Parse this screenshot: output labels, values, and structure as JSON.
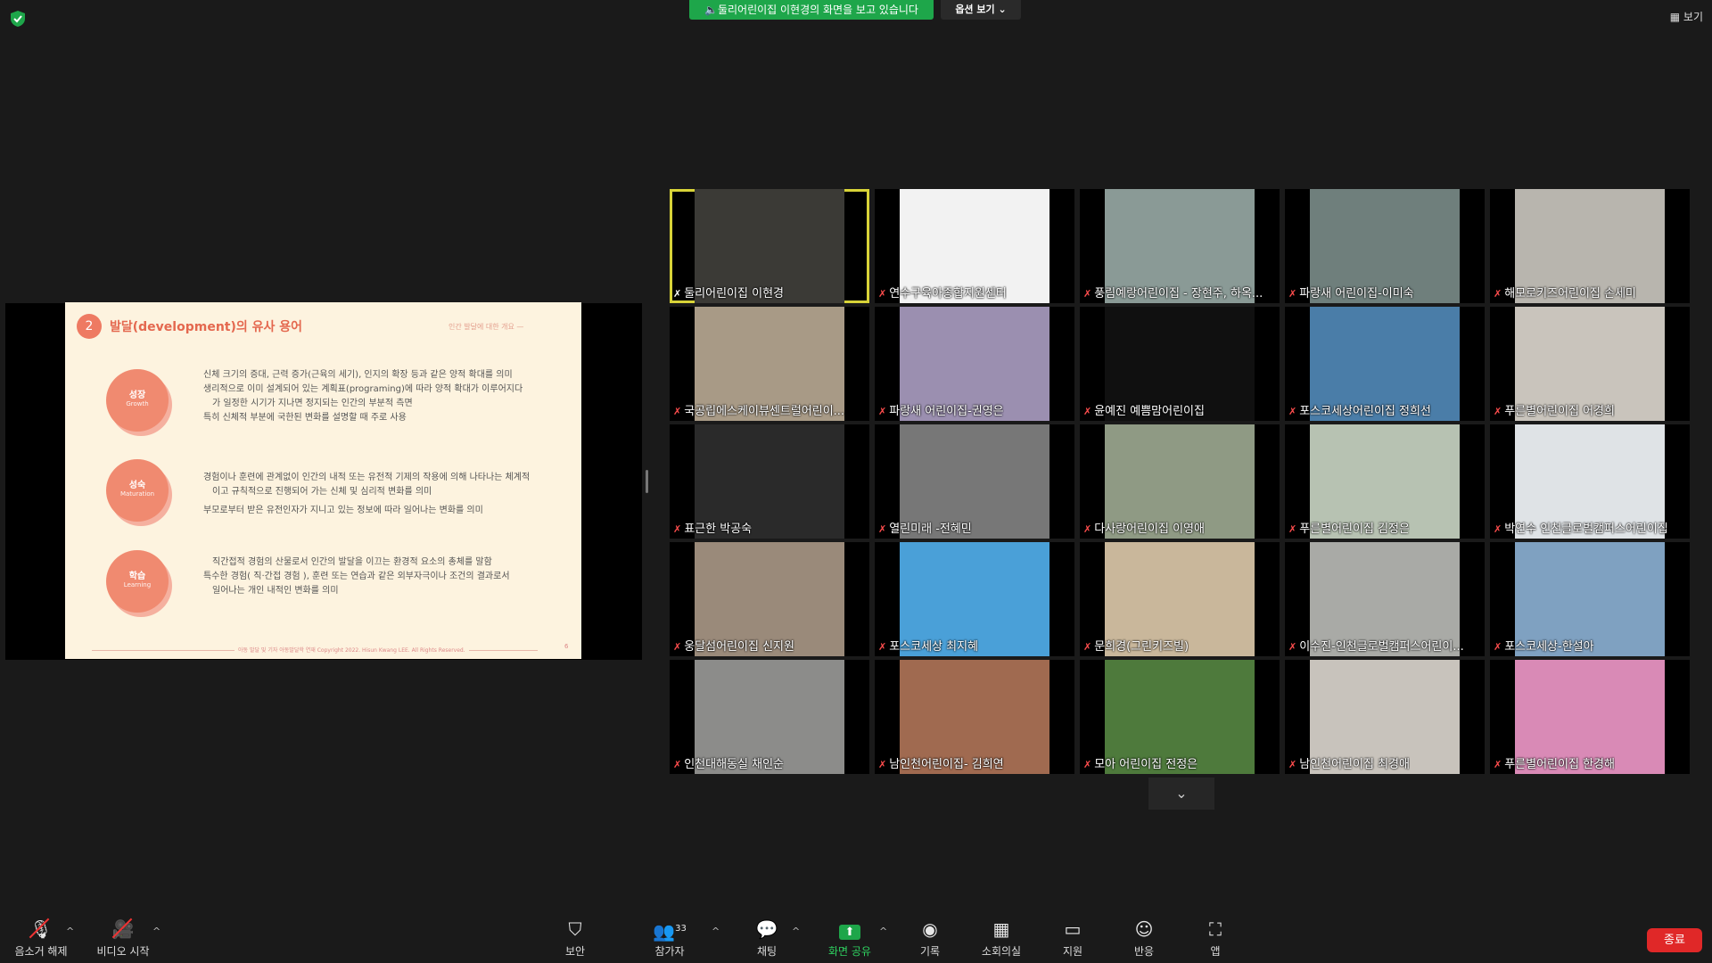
{
  "top_bar": {
    "share_banner": "둘리어린이집 이현경의 화면을 보고 있습니다",
    "view_options": "옵션 보기",
    "view_button": "보기"
  },
  "slide": {
    "number": "2",
    "title": "발달(development)의 유사 용어",
    "subtitle": "인간 발달에 대한 개요",
    "circles": [
      {
        "ko": "성장",
        "en": "Growth"
      },
      {
        "ko": "성숙",
        "en": "Maturation"
      },
      {
        "ko": "학습",
        "en": "Learning"
      }
    ],
    "lines": [
      "신체 크기의 증대, 근력 증가(근육의 세기), 인지의 확장 등과 같은 양적 확대를 의미",
      "생리적으로 이미 설계되어 있는 계획표(programing)에 따라 양적 확대가 이루어지다",
      "가 일정한 시기가 지나면 정지되는 인간의 부분적 측면",
      "특히 신체적 부분에 국한된 변화를 설명할 때 주로 사용",
      "경험이나 훈련에 관계없이 인간의 내적 또는 유전적 기제의 작용에 의해 나타나는 체계적",
      "이고 규칙적으로 진행되어 가는 신체 및 심리적 변화를 의미",
      "부모로부터 받은 유전인자가 지니고 있는 정보에 따라 일어나는 변화를 의미",
      "직간접적 경험의 산물로서 인간의 발달을 이끄는 환경적 요소의 총체를 말함",
      "특수한 경험( 직·간접 경험 ), 훈련 또는 연습과 같은 외부자극이나 조건의 결과로서",
      "일어나는 개인 내적인 변화를 의미"
    ],
    "footer": "아동 발달 및 기자 아동발달학 연재 Copyright 2022. Hisun Kwang LEE. All Rights Reserved.",
    "page": "6"
  },
  "participants": [
    "둘리어린이집 이현경",
    "연수구육아종합지원센터",
    "풍림예랑어린이집 - 장현주, 하옥...",
    "파랑새 어린이집-이미숙",
    "해모로키즈어린이집 손세미",
    "국공립에스케이뷰센트럴어린이...",
    "파랑새 어린이집-권영은",
    "윤예진 예쁨맘어린이집",
    "포스코세상어린이집 정희선",
    "푸른별어린이집 어경희",
    "표근한 박공숙",
    "열린미래 -전혜민",
    "다사랑어린이집 이영애",
    "푸른별어린이집 김정은",
    "박연수 인천글로벌캠퍼스어린이집",
    "웅달섬어린이집 신지원",
    "포스코세상 최지혜",
    "문희경(그린키즈빌)",
    "이수진-인천글로벌캠퍼스어린이...",
    "포스코세상-한설아",
    "인천대해동실 채인순",
    "남인천어린이집- 김희연",
    "모아 어린이집 전정은",
    "남인천어린이집 최경애",
    "푸른별어린이집 한경해"
  ],
  "toolbar": {
    "unmute": "음소거 해제",
    "start_video": "비디오 시작",
    "security": "보안",
    "participants": "참가자",
    "participant_count": "33",
    "chat": "채팅",
    "share_screen": "화면 공유",
    "record": "기록",
    "breakout": "소회의실",
    "whiteboard": "지원",
    "reactions": "반응",
    "apps": "앱",
    "end": "종료"
  },
  "colors": {
    "share_green": "#1ea64a",
    "active_speaker": "#d8d338",
    "end_red": "#e02828",
    "slide_accent": "#e4684f"
  }
}
